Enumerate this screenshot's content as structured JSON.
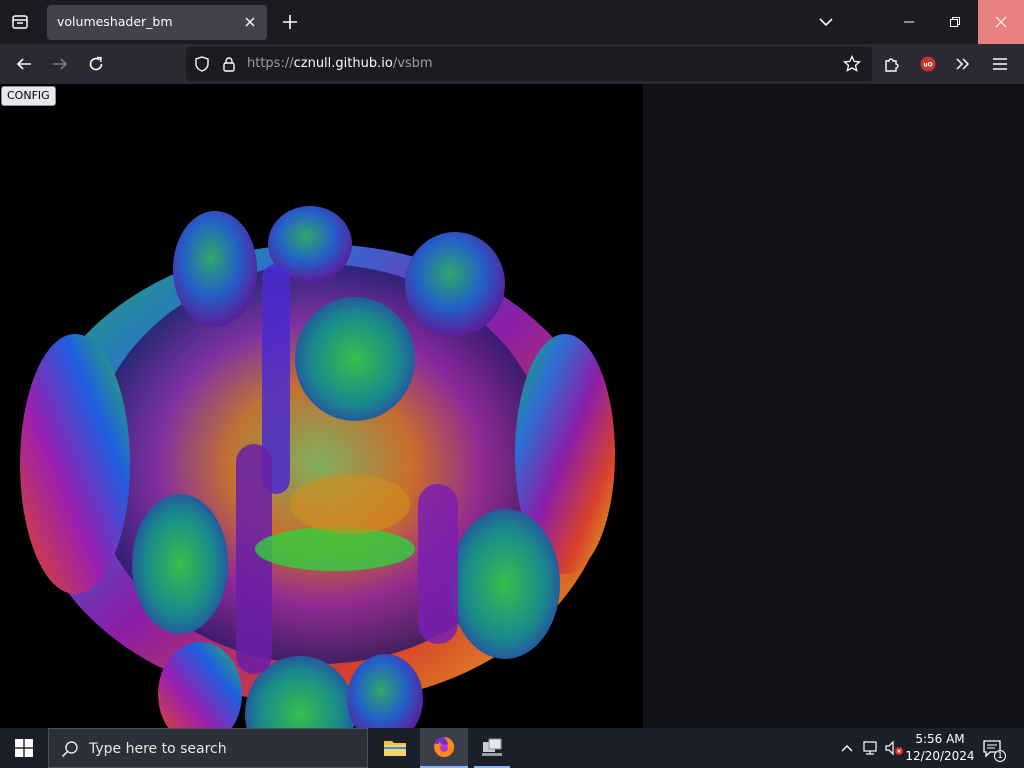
{
  "browser": {
    "tab_title": "volumeshader_bm",
    "url_protocol": "https://",
    "url_host": "cznull.github.io",
    "url_path": "/vsbm"
  },
  "page": {
    "config_label": "CONFIG"
  },
  "taskbar": {
    "search_placeholder": "Type here to search",
    "time": "5:56 AM",
    "date": "12/20/2024",
    "notification_count": "1"
  },
  "colors": {
    "accent": "#8ab4f8",
    "close_hover": "#e88080",
    "ublock": "#c0392b"
  }
}
